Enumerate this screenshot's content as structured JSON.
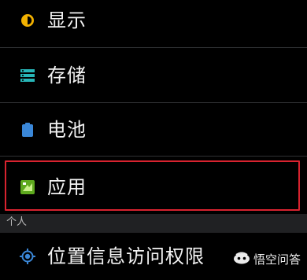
{
  "settings": {
    "items": [
      {
        "label": "显示",
        "icon": "display-brightness-icon"
      },
      {
        "label": "存储",
        "icon": "storage-icon"
      },
      {
        "label": "电池",
        "icon": "battery-icon"
      },
      {
        "label": "应用",
        "icon": "apps-icon",
        "highlighted": true
      },
      {
        "label": "位置信息访问权限",
        "icon": "location-icon"
      }
    ],
    "section_personal": "个人"
  },
  "watermark": {
    "text": "悟空问答",
    "icon": "wukong-logo-icon"
  },
  "colors": {
    "background": "#000000",
    "highlight_border": "#d8232f",
    "section_header_bg": "#202123",
    "accent_blue": "#3a87d8",
    "storage_teal": "#27b5b7",
    "display_yellow": "#f2b100",
    "apps_green": "#5ea91e"
  }
}
